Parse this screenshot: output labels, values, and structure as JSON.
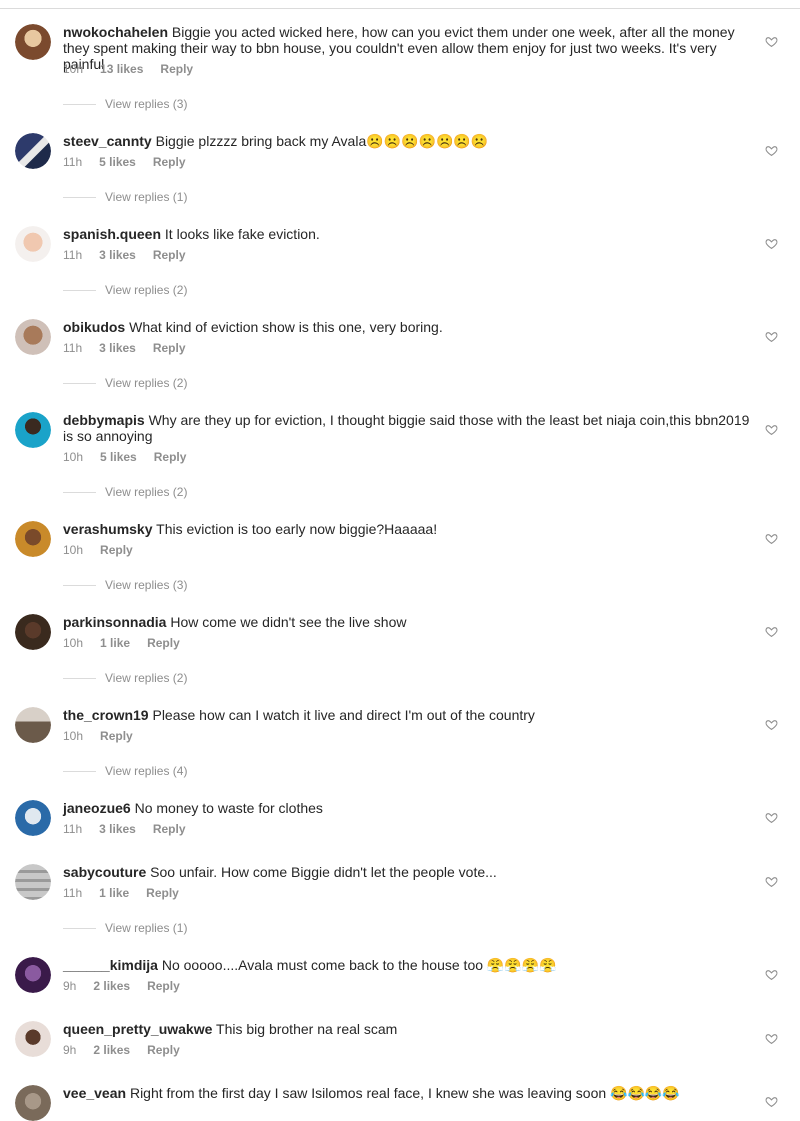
{
  "comments": [
    {
      "user": "nwokochahelen",
      "text": "Biggie you acted wicked here, how can you evict them under one week, after all the money they spent making their way to bbn house, you couldn't even allow them enjoy for just two weeks. It's very painful",
      "time": "10h",
      "likes": "13 likes",
      "reply": "Reply",
      "replies": "View replies (3)",
      "color": "#7b4a2e"
    },
    {
      "user": "steev_cannty",
      "text": "Biggie plzzzz bring back my Avala☹️☹️☹️☹️☹️☹️☹️",
      "time": "11h",
      "likes": "5 likes",
      "reply": "Reply",
      "replies": "View replies (1)",
      "color": "#2d3a6b"
    },
    {
      "user": "spanish.queen",
      "text": "It looks like fake eviction.",
      "time": "11h",
      "likes": "3 likes",
      "reply": "Reply",
      "replies": "View replies (2)",
      "color": "#e0a58a"
    },
    {
      "user": "obikudos",
      "text": "What kind of eviction show is this one, very boring.",
      "time": "11h",
      "likes": "3 likes",
      "reply": "Reply",
      "replies": "View replies (2)",
      "color": "#8a6a5a"
    },
    {
      "user": "debbymapis",
      "text": "Why are they up for eviction, I thought biggie said those with the least bet niaja coin,this bbn2019 is so annoying",
      "time": "10h",
      "likes": "5 likes",
      "reply": "Reply",
      "replies": "View replies (2)",
      "color": "#1aa3c9"
    },
    {
      "user": "verashumsky",
      "text": "This eviction is too early now biggie?Haaaaa!",
      "time": "10h",
      "likes": "",
      "reply": "Reply",
      "replies": "View replies (3)",
      "color": "#c98a2a"
    },
    {
      "user": "parkinsonnadia",
      "text": "How come we didn't see the live show",
      "time": "10h",
      "likes": "1 like",
      "reply": "Reply",
      "replies": "View replies (2)",
      "color": "#3a2a1e"
    },
    {
      "user": "the_crown19",
      "text": "Please how can I watch it live and direct I'm out of the country",
      "time": "10h",
      "likes": "",
      "reply": "Reply",
      "replies": "View replies (4)",
      "color": "#6b5a4a"
    },
    {
      "user": "janeozue6",
      "text": "No money to waste for clothes",
      "time": "11h",
      "likes": "3 likes",
      "reply": "Reply",
      "replies": "",
      "color": "#2a6aa8"
    },
    {
      "user": "sabycouture",
      "text": "Soo unfair. How come Biggie didn't let the people vote...",
      "time": "11h",
      "likes": "1 like",
      "reply": "Reply",
      "replies": "View replies (1)",
      "color": "#b8b8b8"
    },
    {
      "user": "______kimdija",
      "text": "No ooooo....Avala must come back to the house too 😤😤😤😤",
      "time": "9h",
      "likes": "2 likes",
      "reply": "Reply",
      "replies": "",
      "color": "#5a2a6b"
    },
    {
      "user": "queen_pretty_uwakwe",
      "text": "This big brother na real scam",
      "time": "9h",
      "likes": "2 likes",
      "reply": "Reply",
      "replies": "",
      "color": "#d8c8c0"
    },
    {
      "user": "vee_vean",
      "text": "Right from the first day I saw Isilomos real face, I knew she was leaving soon 😂😂😂😂",
      "time": "",
      "likes": "",
      "reply": "",
      "replies": "",
      "color": "#7a6a5a"
    }
  ],
  "icons": {
    "like": "heart-outline-icon"
  }
}
